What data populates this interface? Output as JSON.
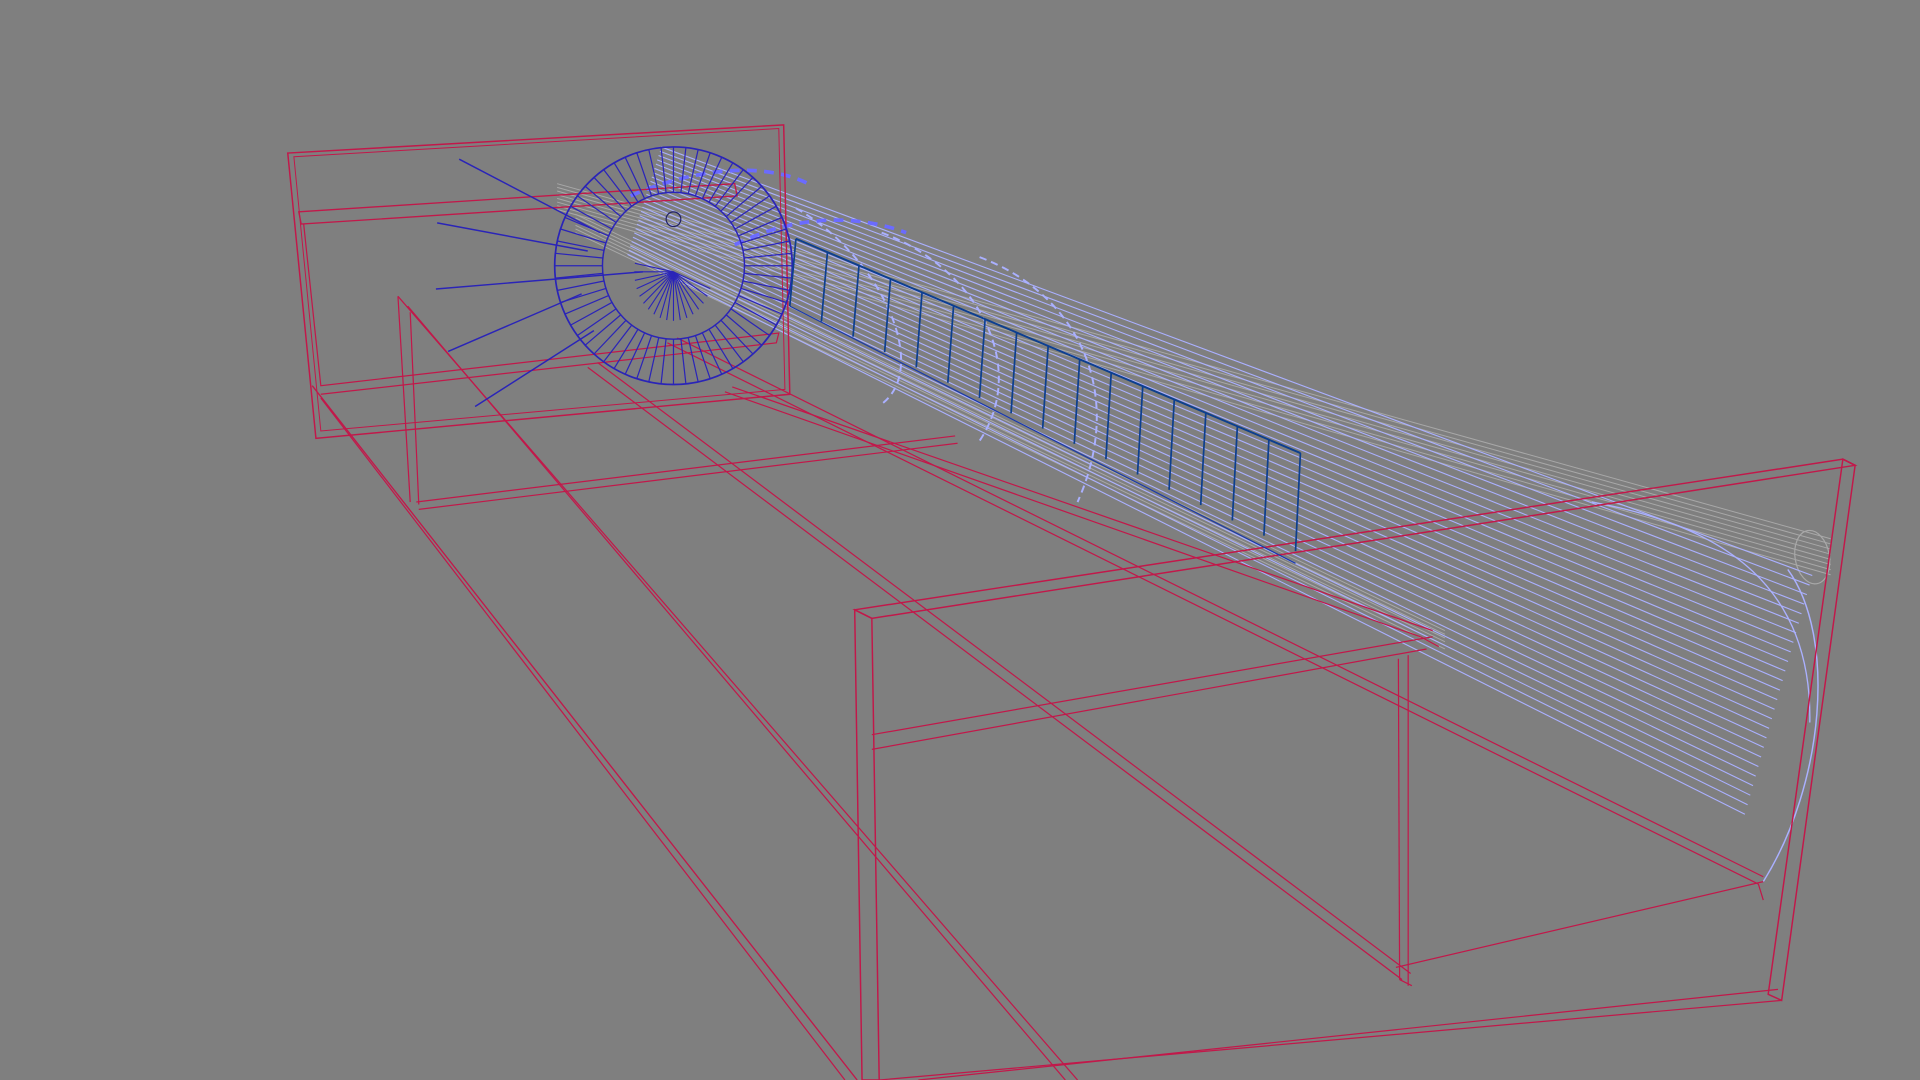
{
  "viewport": {
    "background": "#7f7f7f",
    "render_mode": "wireframe",
    "colors": {
      "structure": "#c2184a",
      "tunnel": "#aab0ff",
      "grey_pipe": "#a8a8a8",
      "spiral_stair": "#2a24b8",
      "railing": "#1a3aa8",
      "stringer": "#0d3f8f"
    }
  }
}
